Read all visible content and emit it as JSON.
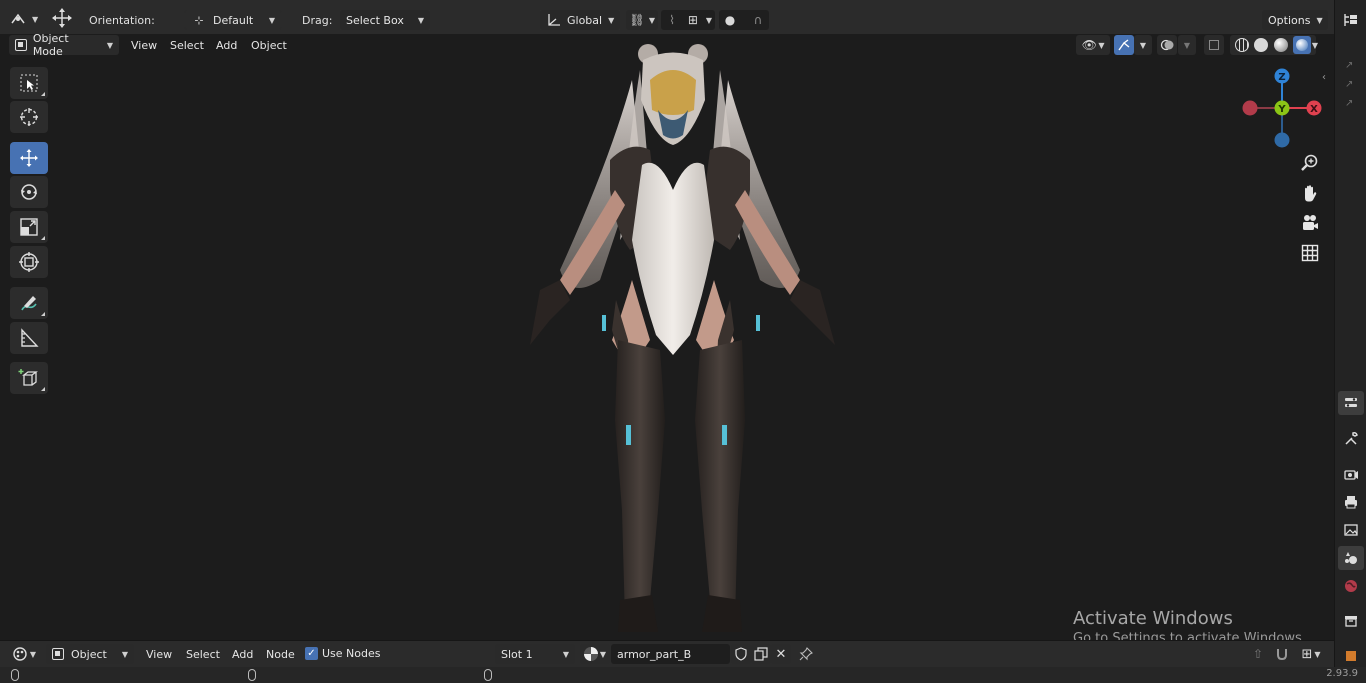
{
  "header": {
    "orientation_label": "Orientation:",
    "orientation_value": "Default",
    "drag_label": "Drag:",
    "drag_value": "Select Box",
    "transform_space": "Global",
    "options_label": "Options"
  },
  "viewport_header": {
    "mode": "Object Mode",
    "menu": [
      "View",
      "Select",
      "Add",
      "Object"
    ]
  },
  "gizmo": {
    "z": "Z",
    "y": "Y",
    "x": "X"
  },
  "node_editor": {
    "type": "Object",
    "menu": [
      "View",
      "Select",
      "Add",
      "Node"
    ],
    "use_nodes_label": "Use Nodes",
    "use_nodes_checked": true,
    "slot": "Slot 1",
    "material_name": "armor_part_B"
  },
  "watermark": {
    "title": "Activate Windows",
    "subtitle": "Go to Settings to activate Windows."
  },
  "status": {
    "version": "2.93.9"
  },
  "colors": {
    "accent": "#4772b3",
    "axis_x": "#e0414f",
    "axis_y": "#8bc516",
    "axis_z": "#2f83d6"
  }
}
